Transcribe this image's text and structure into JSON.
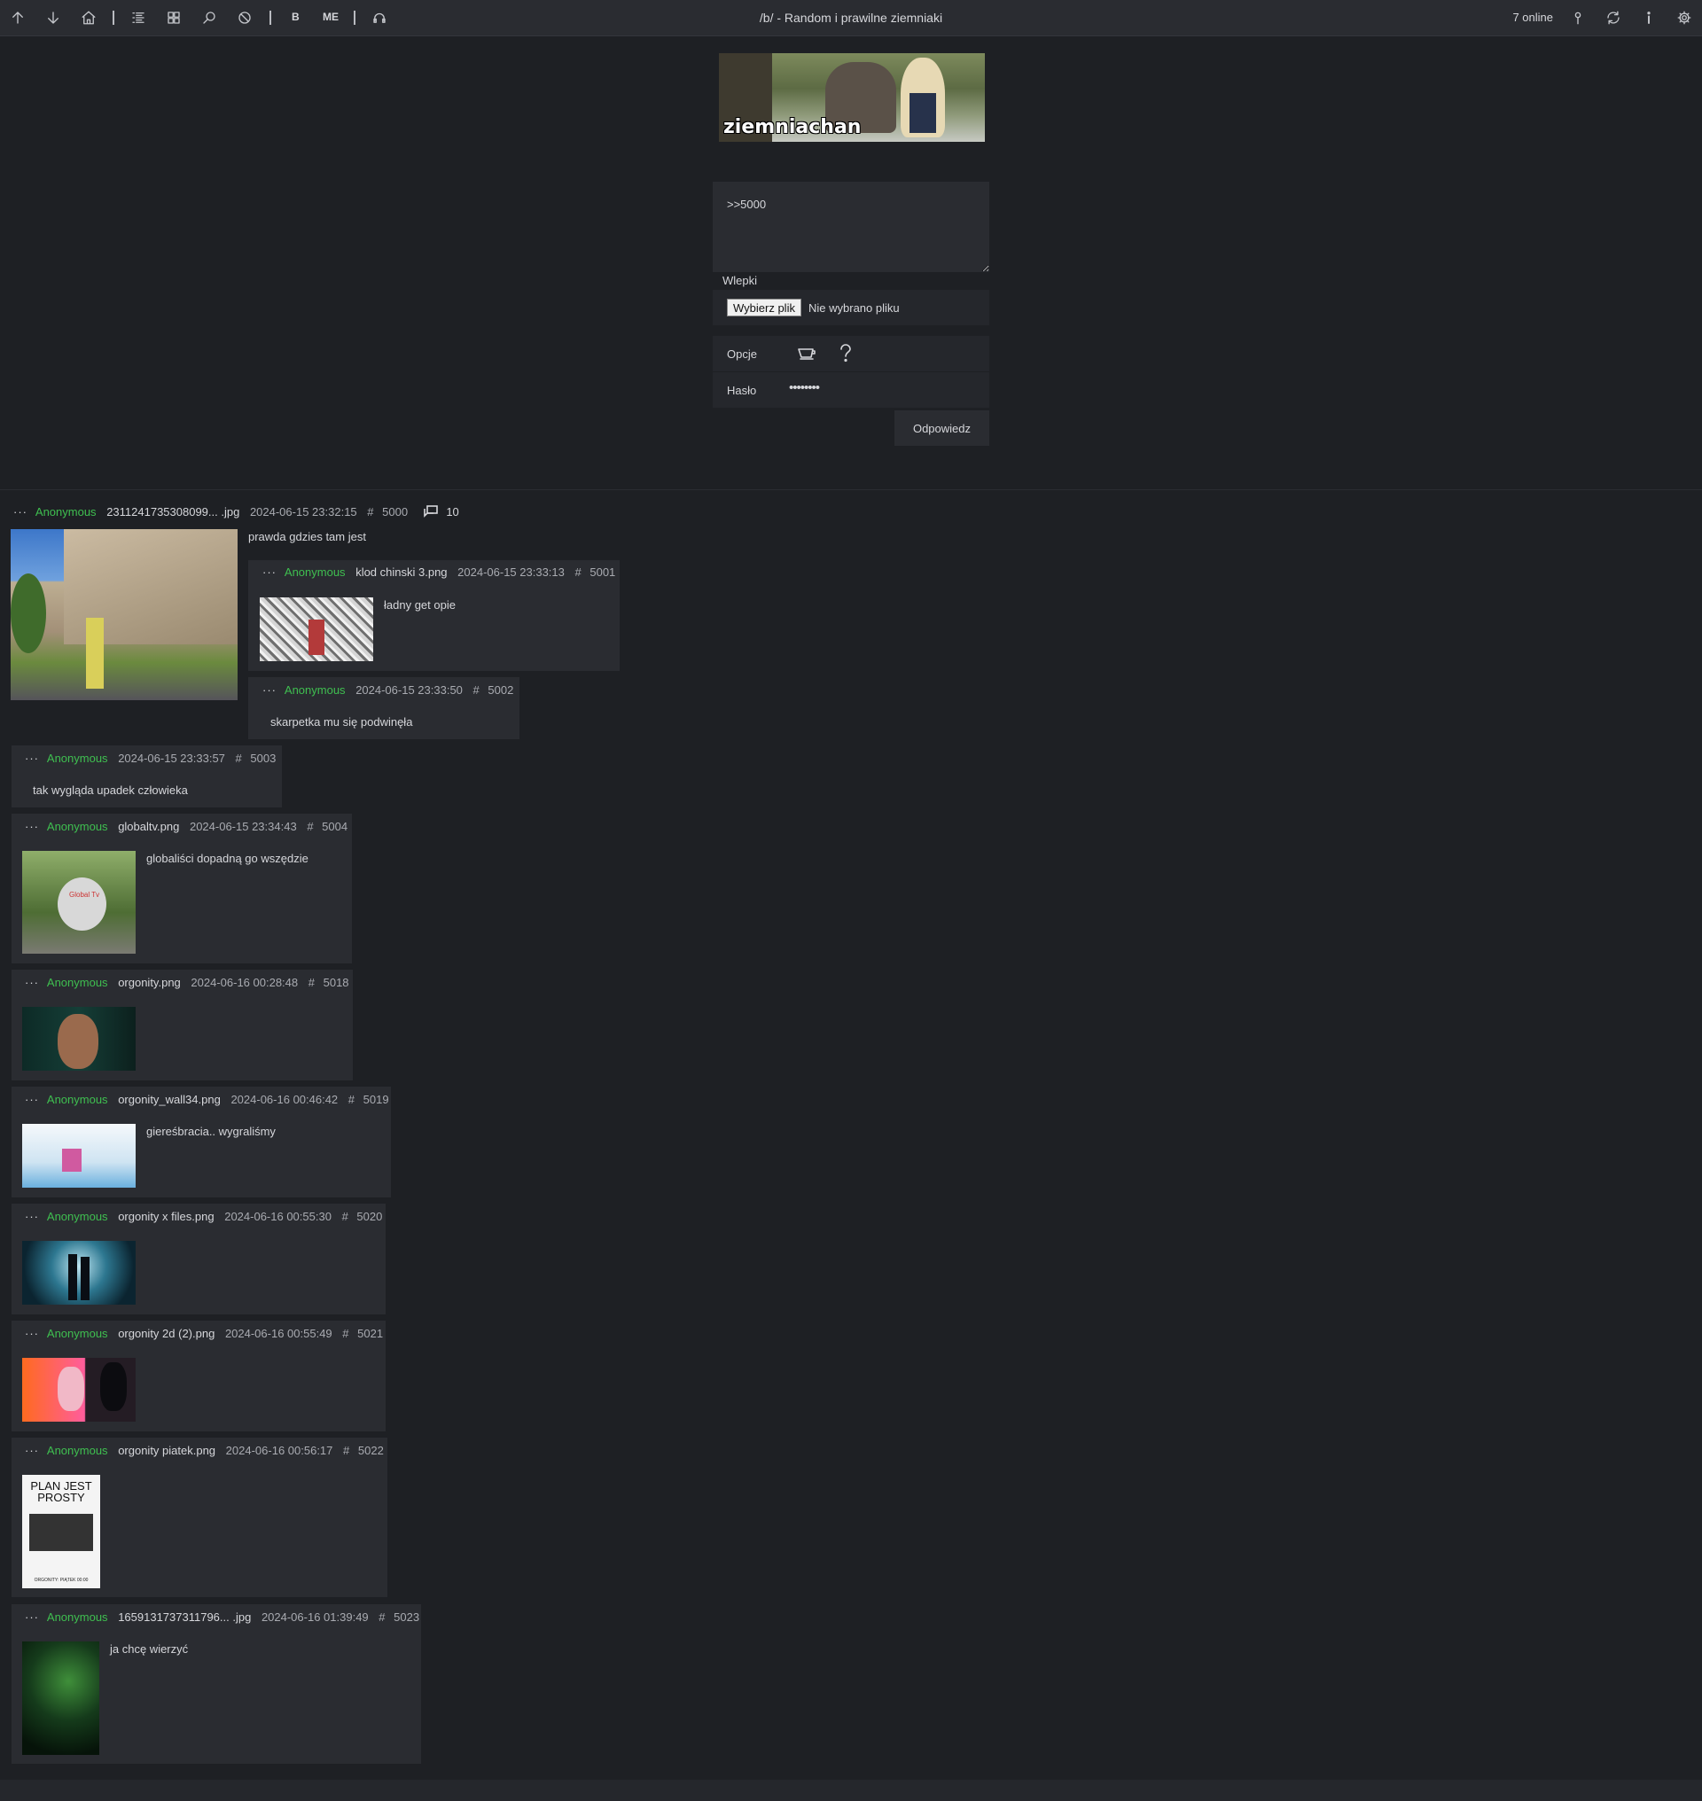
{
  "toolbar": {
    "board_title": "/b/ - Random i prawilne ziemniaki",
    "bold_label": "B",
    "me_label": "ME",
    "online": "7 online",
    "icons": [
      "arrow-up-icon",
      "arrow-down-icon",
      "home-icon",
      "list-icon",
      "grid-icon",
      "search-icon",
      "ban-icon",
      "headphones-icon",
      "pin-icon",
      "refresh-icon",
      "info-icon",
      "gear-icon"
    ]
  },
  "banner": {
    "text": "ziemniachan"
  },
  "form": {
    "message": ">>5000",
    "stickers_label": "Wlepki",
    "file_button": "Wybierz plik",
    "file_status": "Nie wybrano pliku",
    "options_label": "Opcje",
    "password_label": "Hasło",
    "password_mask": "••••••••",
    "submit_label": "Odpowiedz"
  },
  "op": {
    "name": "Anonymous",
    "file": "2311241735308099... .jpg",
    "date": "2024-06-15 23:32:15",
    "hash": "#",
    "number": "5000",
    "reply_count": "10",
    "message": "prawda gdzies tam jest"
  },
  "replies": [
    {
      "name": "Anonymous",
      "file": "klod chinski 3.png",
      "date": "2024-06-15 23:33:13",
      "number": "5001",
      "message": "ładny get opie"
    },
    {
      "name": "Anonymous",
      "file": "",
      "date": "2024-06-15 23:33:50",
      "number": "5002",
      "message": "skarpetka mu się podwinęła"
    },
    {
      "name": "Anonymous",
      "file": "",
      "date": "2024-06-15 23:33:57",
      "number": "5003",
      "message": "tak wygląda upadek człowieka"
    },
    {
      "name": "Anonymous",
      "file": "globaltv.png",
      "date": "2024-06-15 23:34:43",
      "number": "5004",
      "message": "globaliści dopadną go wszędzie"
    },
    {
      "name": "Anonymous",
      "file": "orgonity.png",
      "date": "2024-06-16 00:28:48",
      "number": "5018",
      "message": ""
    },
    {
      "name": "Anonymous",
      "file": "orgonity_wall34.png",
      "date": "2024-06-16 00:46:42",
      "number": "5019",
      "message": "giereśbracia.. wygraliśmy"
    },
    {
      "name": "Anonymous",
      "file": "orgonity x files.png",
      "date": "2024-06-16 00:55:30",
      "number": "5020",
      "message": ""
    },
    {
      "name": "Anonymous",
      "file": "orgonity 2d (2).png",
      "date": "2024-06-16 00:55:49",
      "number": "5021",
      "message": ""
    },
    {
      "name": "Anonymous",
      "file": "orgonity piatek.png",
      "date": "2024-06-16 00:56:17",
      "number": "5022",
      "message": ""
    },
    {
      "name": "Anonymous",
      "file": "1659131737311796... .jpg",
      "date": "2024-06-16 01:39:49",
      "number": "5023",
      "message": "ja chcę wierzyć"
    }
  ],
  "thumb_texts": {
    "plan_line1": "PLAN JEST",
    "plan_line2": "PROSTY",
    "plan_footer": "ORGONITY: PIĄTEK 00:00",
    "globaltv_label": "Global Tv"
  }
}
